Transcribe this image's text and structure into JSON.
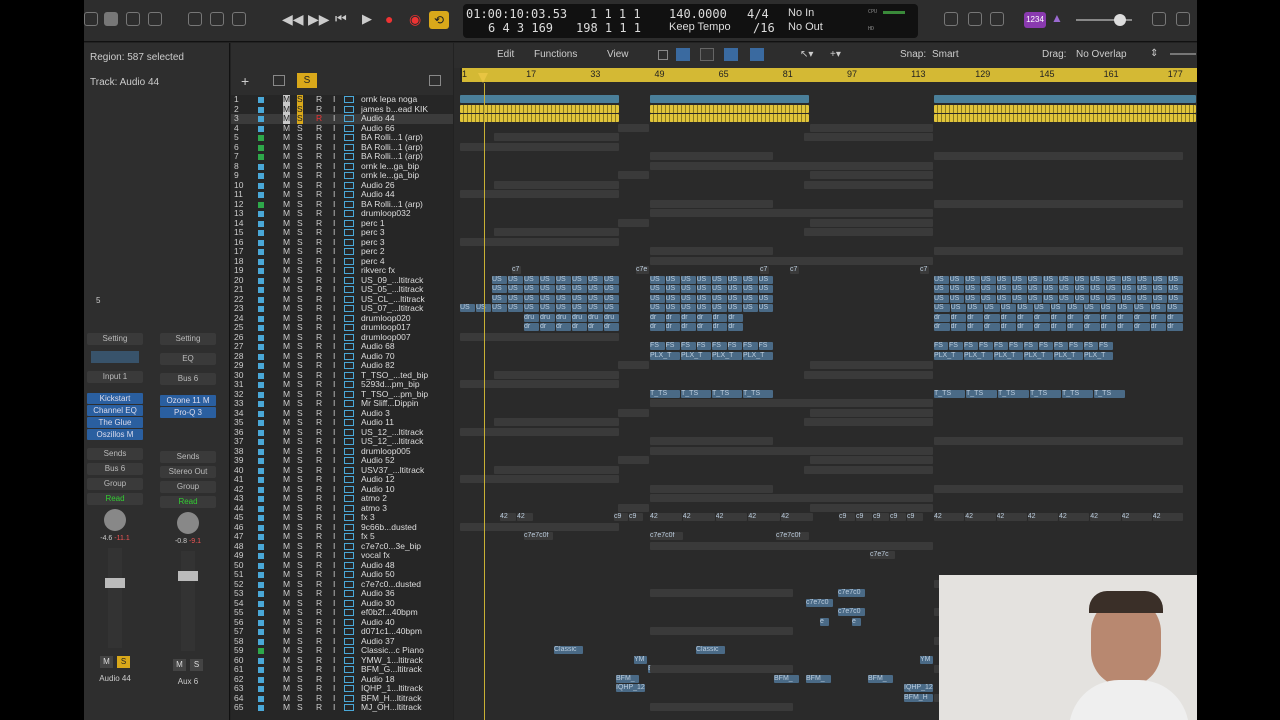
{
  "control_bar": {
    "position": "01:00:10:03.53",
    "bars": "1  1  1    1",
    "sub": "6  4  3  169",
    "bars2": "198  1  1    1",
    "tempo": "140.0000",
    "tempo_mode": "Keep Tempo",
    "sig": "4/4",
    "div": "/16",
    "in": "No In",
    "out": "No Out",
    "user_badge": "1234",
    "cpu_label": "CPU",
    "hd_label": "HD"
  },
  "inspector": {
    "region": "Region: 587 selected",
    "track": "Track: Audio 44",
    "num": "5",
    "ch1": {
      "setting": "Setting",
      "input": "Input 1",
      "plugins": [
        "Kickstart",
        "Channel EQ",
        "The Glue",
        "Oszillos M"
      ],
      "sends": "Sends",
      "bus": "Bus 6",
      "group": "Group",
      "auto": "Read",
      "vol": "-4.6",
      "peak": "-11.1",
      "m": "M",
      "s": "S",
      "name": "Audio 44"
    },
    "ch2": {
      "setting": "Setting",
      "eq": "EQ",
      "input": "Bus 6",
      "plugins": [
        "Ozone 11 M",
        "Pro-Q 3"
      ],
      "sends": "Sends",
      "bus": "Stereo Out",
      "group": "Group",
      "auto": "Read",
      "vol": "-0.8",
      "peak": "-9.1",
      "m": "M",
      "s": "S",
      "name": "Aux 6"
    }
  },
  "menu": {
    "edit": "Edit",
    "functions": "Functions",
    "view": "View",
    "snap_label": "Snap:",
    "snap": "Smart",
    "drag_label": "Drag:",
    "drag": "No Overlap"
  },
  "ruler": [
    "1",
    "17",
    "33",
    "49",
    "65",
    "81",
    "97",
    "113",
    "129",
    "145",
    "161",
    "177"
  ],
  "track_buttons": {
    "m": "M",
    "s": "S",
    "r": "R",
    "i": "I",
    "solo_header": "S"
  },
  "tracks": [
    "ornk lepa noga",
    "james b...ead KIK",
    "Audio 44",
    "Audio 66",
    "BA Rolli...1 (arp)",
    "BA Rolli...1 (arp)",
    "BA Rolli...1 (arp)",
    "ornk le...ga_bip",
    "ornk le...ga_bip",
    "Audio 26",
    "Audio 44",
    "BA Rolli...1 (arp)",
    "drumloop032",
    "perc 1",
    "perc 3",
    "perc 3",
    "perc 2",
    "perc 4",
    "rikverc fx",
    "US_09_...ltitrack",
    "US_05_...ltitrack",
    "US_CL_...ltitrack",
    "US_07_...ltitrack",
    "drumloop020",
    "drumloop017",
    "drumloop007",
    "Audio 68",
    "Audio 70",
    "Audio 82",
    "T_TSO_...ted_bip",
    "5293d...pm_bip",
    "T_TSO_...pm_bip",
    "Mr Sliff...Dippin",
    "Audio 3",
    "Audio 11",
    "US_12_...ltitrack",
    "US_12_...ltitrack",
    "drumloop005",
    "Audio 52",
    "USV37_...ltitrack",
    "Audio 12",
    "Audio 10",
    "atmo 2",
    "atmo 3",
    "fx 3",
    "9c66b...dusted",
    "fx 5",
    "c7e7c0...3e_bip",
    "vocal fx",
    "Audio 48",
    "Audio 50",
    "c7e7c0...dusted",
    "Audio 36",
    "Audio 30",
    "ef0b2f...40bpm",
    "Audio 40",
    "d071c1...40bpm",
    "Audio 37",
    "Classic...c Piano",
    "YMW_1...ltitrack",
    "BFM_G...ltitrack",
    "Audio 18",
    "IQHP_1...ltitrack",
    "BFM_H...ltitrack",
    "MJ_OH...ltitrack"
  ],
  "region_labels": {
    "c7": "c7",
    "c7e": "c7e",
    "us": "US",
    "dru": "dru",
    "dr": "dr",
    "fs": "FS",
    "plx": "PLX_T",
    "t_ts": "T_TS",
    "c9": "c9",
    "n42": "42",
    "c7e7c0f": "c7e7c0f",
    "c7e7c": "c7e7c",
    "c7e7c0": "c7e7c0",
    "classic": "Classic",
    "ym": "YM",
    "bfm": "BFM_",
    "iqhp": "IQHP_128",
    "iqhp12": "IQHP_12",
    "bfm_h": "BFM_H",
    "e": "e"
  },
  "colors": {
    "yellow": "#d4b934",
    "blue": "#4a6a86",
    "gray": "#3a3a3a",
    "green": "#2ea84a",
    "cyan": "#4aa8d8"
  }
}
